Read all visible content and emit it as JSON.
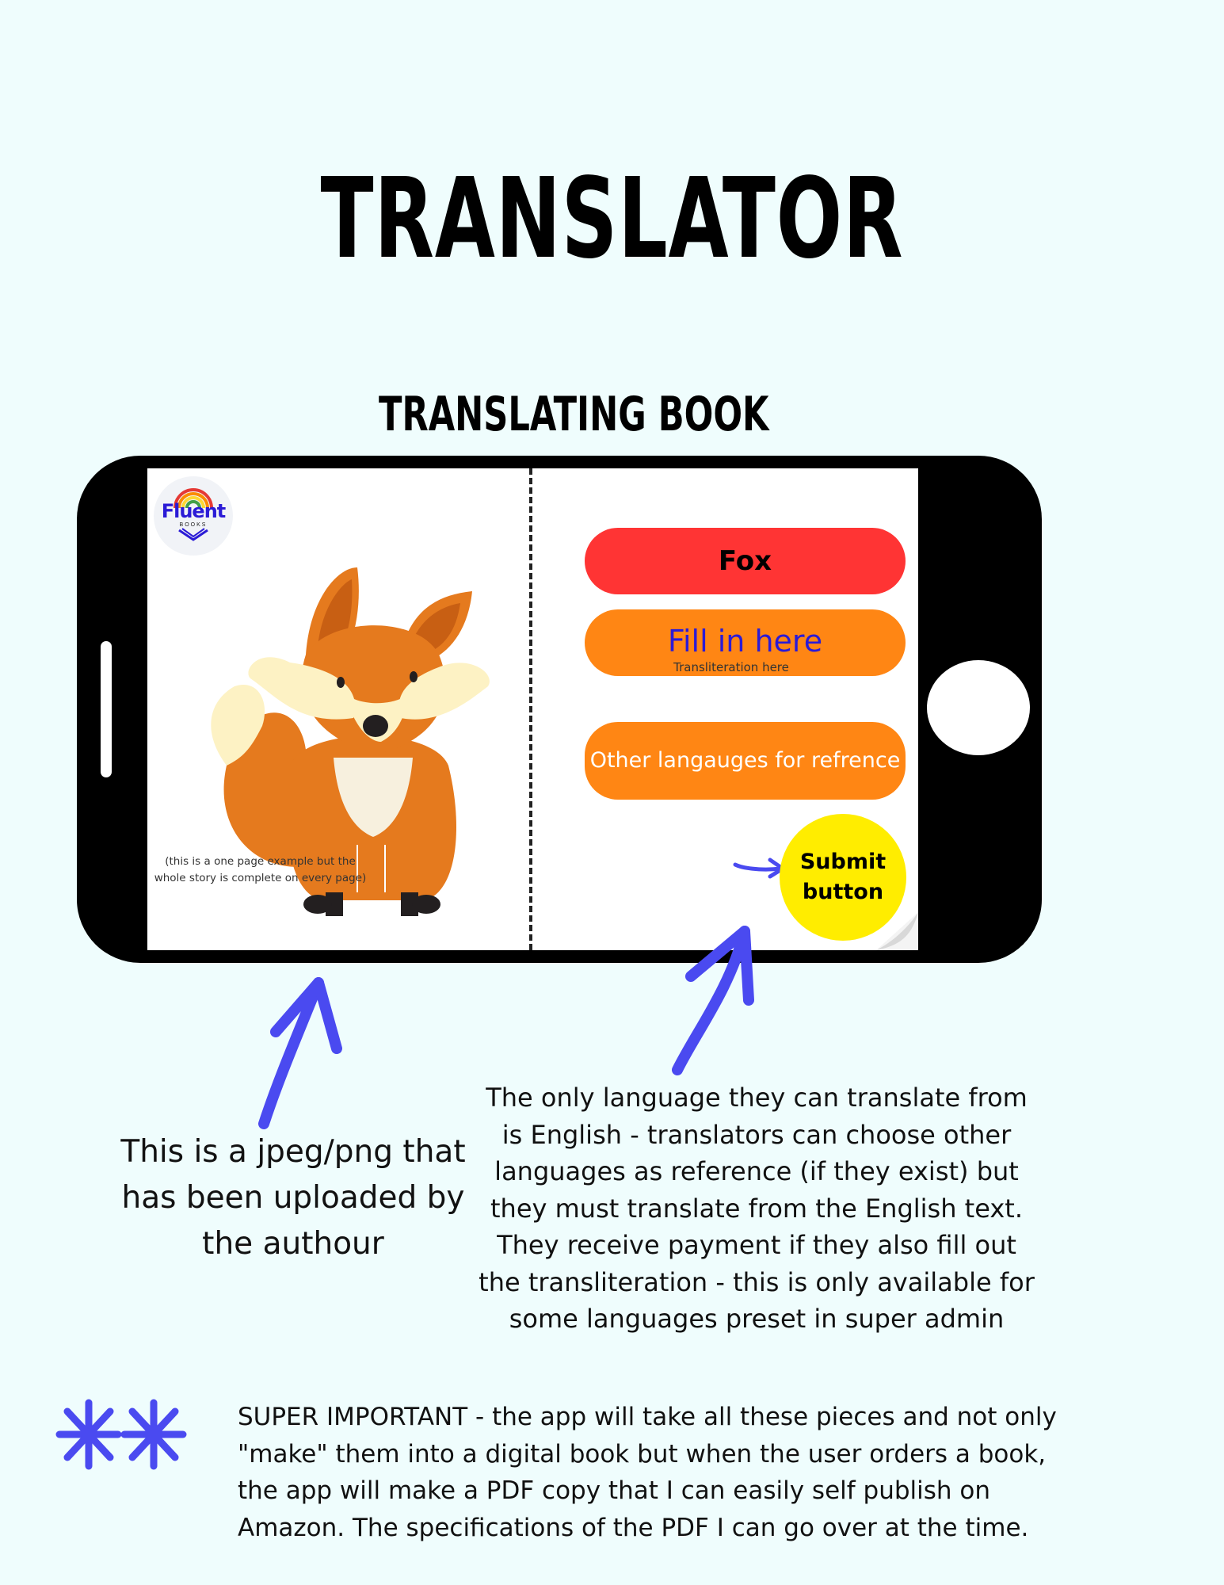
{
  "page": {
    "title": "TRANSLATOR",
    "subtitle": "TRANSLATING BOOK"
  },
  "logo": {
    "text": "Fluent",
    "subtext": "BOOKS"
  },
  "form": {
    "source_word": "Fox",
    "translation_placeholder": "Fill in here",
    "transliteration_placeholder": "Transliteration here",
    "reference_button": "Other langauges for refrence",
    "submit_line1": "Submit",
    "submit_line2": "button"
  },
  "note": {
    "line1": "(this is a one page example but the",
    "line2": "whole story is complete on every page)"
  },
  "captions": {
    "left": [
      "This is a jpeg/png that",
      "has been uploaded by",
      "the authour"
    ],
    "right": [
      "The only language they can translate from",
      "is English - translators can choose other",
      "languages as reference (if they exist) but",
      "they must translate from the English text.",
      "They receive payment if they also fill out",
      "the transliteration - this is only available for",
      "some languages preset in super admin"
    ],
    "super": [
      "SUPER IMPORTANT - the app will take all these pieces and not only",
      "\"make\" them into a digital book but when the user orders a book,",
      "the app will make a PDF copy that I can easily self publish on",
      "Amazon. The specifications of the PDF I can go over at the time."
    ]
  },
  "colors": {
    "background": "#effdfd",
    "fox_pill": "#ff3434",
    "orange_pill": "#ff8614",
    "submit": "#ffed00",
    "accent_blue": "#4a4af0",
    "placeholder_blue": "#2b1bd6"
  },
  "icons": [
    "fluent-books-logo",
    "fox-illustration",
    "arrow-icon",
    "asterisk-icon"
  ]
}
